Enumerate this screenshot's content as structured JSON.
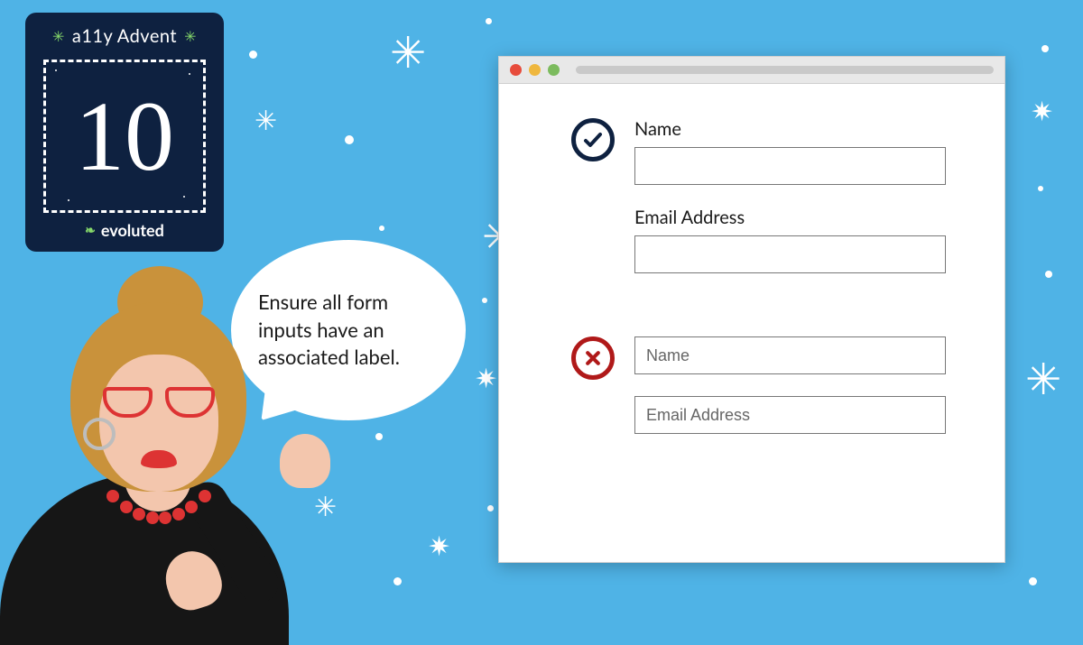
{
  "card": {
    "title": "a11y Advent",
    "day": "10",
    "brand": "evoluted"
  },
  "bubble": {
    "text": "Ensure all form inputs have an associated label."
  },
  "window": {
    "good": {
      "fields": [
        {
          "label": "Name"
        },
        {
          "label": "Email Address"
        }
      ]
    },
    "bad": {
      "fields": [
        {
          "placeholder": "Name"
        },
        {
          "placeholder": "Email Address"
        }
      ]
    }
  }
}
